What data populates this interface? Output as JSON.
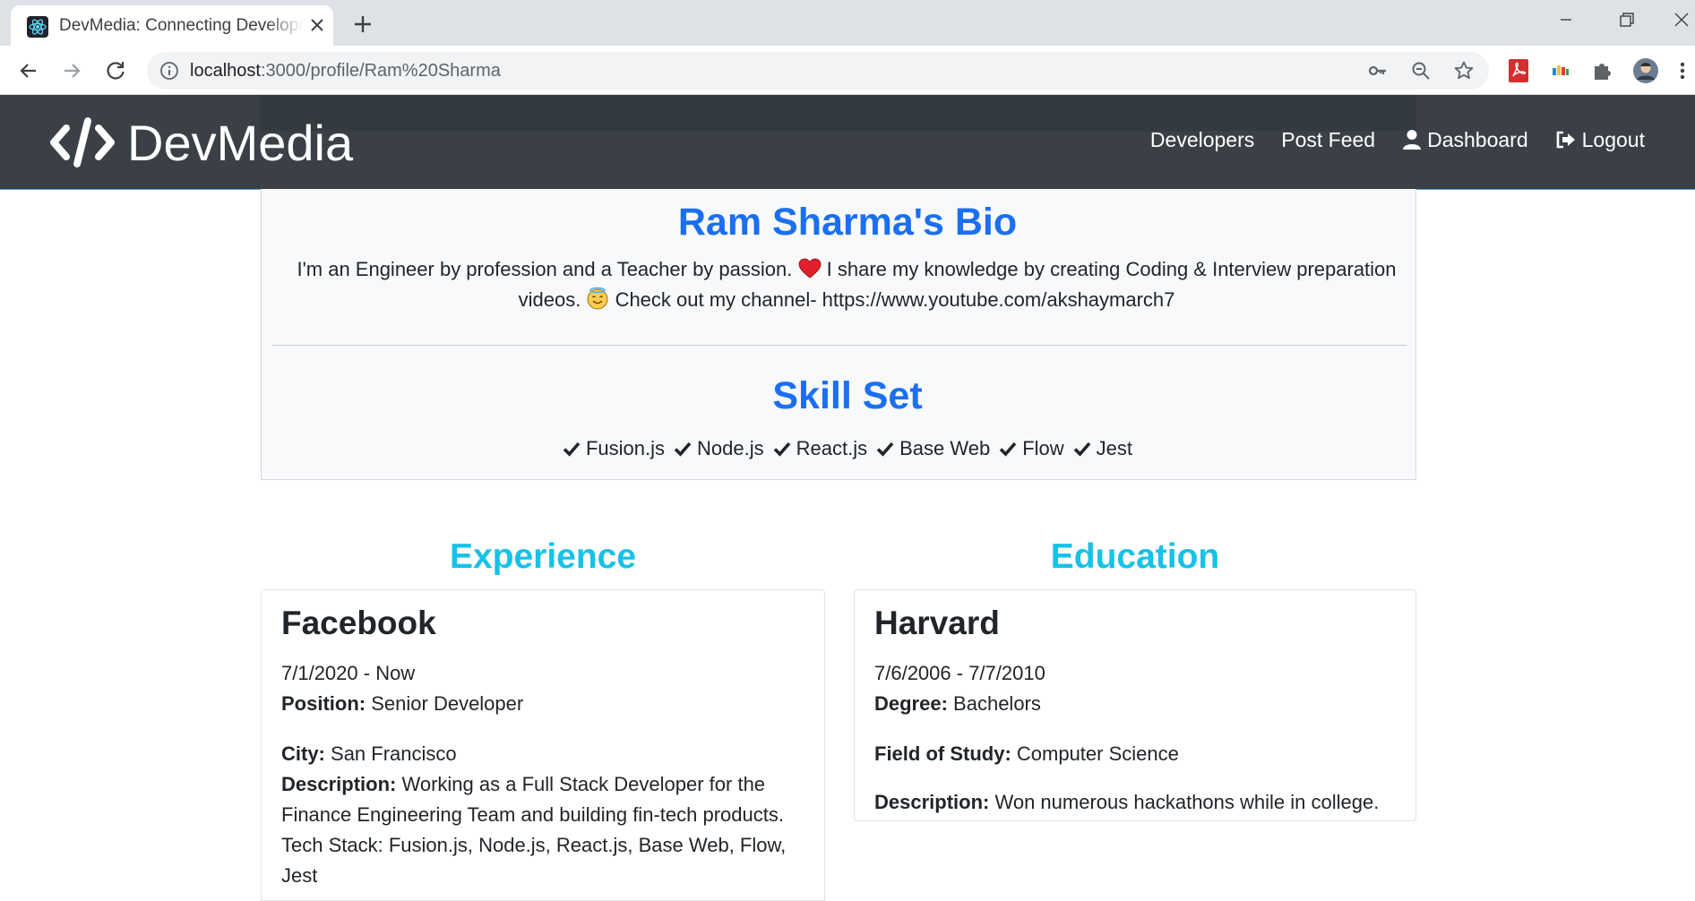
{
  "browser": {
    "tab_title": "DevMedia: Connecting Developers",
    "url_host": "localhost",
    "url_path": ":3000/profile/Ram%20Sharma"
  },
  "navbar": {
    "brand": "DevMedia",
    "links": {
      "developers": "Developers",
      "post_feed": "Post Feed",
      "dashboard": "Dashboard",
      "logout": "Logout"
    }
  },
  "bio": {
    "title": "Ram Sharma's Bio",
    "text_part1": "I'm an Engineer by profession and a Teacher by passion.",
    "text_part2": "I share my knowledge by creating Coding & Interview preparation videos.",
    "text_part3": "Check out my channel- https://www.youtube.com/akshaymarch7"
  },
  "skills": {
    "title": "Skill Set",
    "items": [
      "Fusion.js",
      "Node.js",
      "React.js",
      "Base Web",
      "Flow",
      "Jest"
    ]
  },
  "experience": {
    "heading": "Experience",
    "company": "Facebook",
    "dates": "7/1/2020 - Now",
    "position_label": "Position:",
    "position": "Senior Developer",
    "city_label": "City:",
    "city": "San Francisco",
    "description_label": "Description:",
    "description": "Working as a Full Stack Developer for the Finance Engineering Team and building fin-tech products. Tech Stack: Fusion.js, Node.js, React.js, Base Web, Flow, Jest"
  },
  "education": {
    "heading": "Education",
    "school": "Harvard",
    "dates": "7/6/2006 - 7/7/2010",
    "degree_label": "Degree:",
    "degree": "Bachelors",
    "field_label": "Field of Study:",
    "field": "Computer Science",
    "description_label": "Description:",
    "description": "Won numerous hackathons while in college."
  },
  "colors": {
    "navbar": "#343a40",
    "primary": "#1b6ff0",
    "info": "#17c1e8"
  }
}
